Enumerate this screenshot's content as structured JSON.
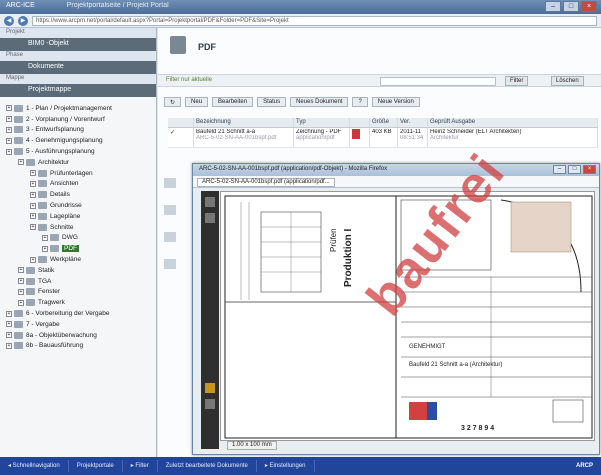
{
  "window": {
    "title_app": "ARC-ICE",
    "title_project": "Projektportalseite / Projekt Portal",
    "url": "https://www.arcpm.net/portal/default.aspx?Portal=Projektportal/PDF&Folder=PDF&Site=Projekt",
    "min": "–",
    "max": "□",
    "close": "×"
  },
  "left": {
    "header1": "Projekt",
    "selected1": "BIM0 -Objekt",
    "header2": "Phase",
    "selected2": "Dokumente",
    "header3": "Mappe",
    "selected3": "Projektmappe",
    "tree": [
      {
        "level": 0,
        "label": "1 - Plan / Projektmanagement"
      },
      {
        "level": 0,
        "label": "2 - Vorplanung / Vorentwurf"
      },
      {
        "level": 0,
        "label": "3 - Entwurfsplanung"
      },
      {
        "level": 0,
        "label": "4 - Genehmigungsplanung"
      },
      {
        "level": 0,
        "label": "5 - Ausführungsplanung"
      },
      {
        "level": 1,
        "label": "Architektur"
      },
      {
        "level": 2,
        "label": "Prüfunterlagen"
      },
      {
        "level": 2,
        "label": "Ansichten"
      },
      {
        "level": 2,
        "label": "Details"
      },
      {
        "level": 2,
        "label": "Grundrisse"
      },
      {
        "level": 2,
        "label": "Lagepläne"
      },
      {
        "level": 2,
        "label": "Schnitte"
      },
      {
        "level": 3,
        "label": "DWG"
      },
      {
        "level": 3,
        "label": "PDF",
        "selected": true
      },
      {
        "level": 2,
        "label": "Werkpläne"
      },
      {
        "level": 1,
        "label": "Statik"
      },
      {
        "level": 1,
        "label": "TGA"
      },
      {
        "level": 1,
        "label": "Fenster"
      },
      {
        "level": 1,
        "label": "Tragwerk"
      },
      {
        "level": 0,
        "label": "6 - Vorbereitung der Vergabe"
      },
      {
        "level": 0,
        "label": "7 - Vergabe"
      },
      {
        "level": 0,
        "label": "8a - Objektüberwachung"
      },
      {
        "level": 0,
        "label": "8b - Bauausführung"
      }
    ]
  },
  "main": {
    "title": "PDF",
    "filter_label": "Filter nur aktuelle",
    "filter_button": "Filter",
    "reset_button": "Löschen",
    "toolbar": [
      "↻",
      "Neu",
      "Bearbeiten",
      "Status",
      "Neues Dokument",
      "?",
      "Neue Version"
    ],
    "columns": [
      "",
      "Bezeichnung",
      "Typ",
      "",
      "Größe",
      "Ver.",
      "Geprüft Ausgabe"
    ],
    "rows": [
      {
        "mark": "✓",
        "name": "Baufeld 21 Schnitt a-a",
        "name2": "ARC-5-02-SN-AA-001bspf.pdf",
        "type": "Zeichnung - PDF",
        "type2": "application/pdf",
        "size": "403 KB",
        "ver": "2011-11",
        "ver2": "08:51:34",
        "by": "Heinz Schneider (ELT Architekten)",
        "by2": "Architektur"
      }
    ]
  },
  "popup": {
    "title": "ARC-5-02-SN-AA-001bspf.pdf (application/pdf-Objekt) - Mozilla Firefox",
    "tab": "ARC-5-02-SN-AA-001bspf.pdf (application/pdf...",
    "zoom": "1.00 x 100 mm",
    "watermark": "baufrei",
    "plan_text1": "Prüfen",
    "plan_text2": "Produktion I",
    "stamp_text": "GENEHMIGT",
    "sheet_number": "3 2 7 8 9 4",
    "sheet_title": "Baufeld 21 Schnitt a-a (Architektur)"
  },
  "bottom": [
    "◂ Schnellnavigation",
    "Projektportale",
    "▸ Filter",
    "Zuletzt bearbeitete Dokumente",
    "▸ Einstellungen"
  ],
  "bottom_logo": "ARCP"
}
